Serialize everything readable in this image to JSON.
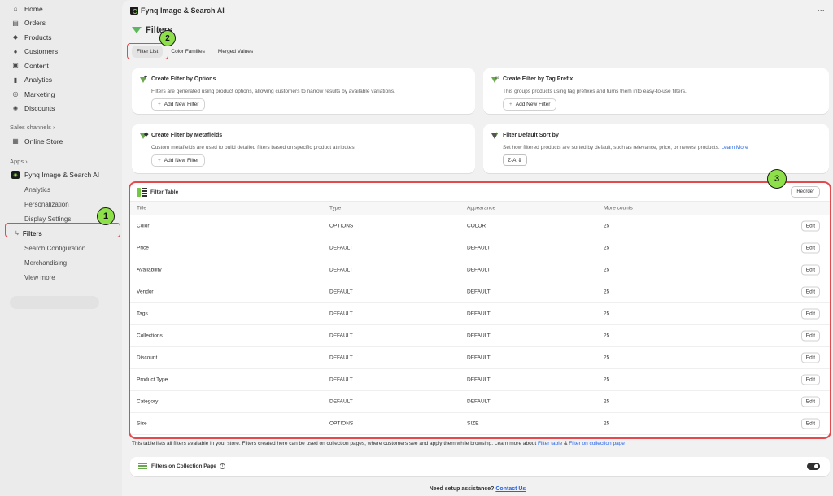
{
  "sidebar": {
    "nav": [
      {
        "label": "Home",
        "icon": "home-icon"
      },
      {
        "label": "Orders",
        "icon": "orders-icon"
      },
      {
        "label": "Products",
        "icon": "tag-icon"
      },
      {
        "label": "Customers",
        "icon": "person-icon"
      },
      {
        "label": "Content",
        "icon": "content-icon"
      },
      {
        "label": "Analytics",
        "icon": "bar-chart-icon"
      },
      {
        "label": "Marketing",
        "icon": "target-icon"
      },
      {
        "label": "Discounts",
        "icon": "discount-icon"
      }
    ],
    "sales_channels_label": "Sales channels",
    "online_store": "Online Store",
    "apps_label": "Apps",
    "app_name": "Fynq Image & Search AI",
    "app_sub": [
      "Analytics",
      "Personalization",
      "Display Settings",
      "Filters",
      "Search Configuration",
      "Merchandising",
      "View more"
    ]
  },
  "header": {
    "app_title": "Fynq Image & Search AI",
    "more": "···"
  },
  "page": {
    "title": "Filters",
    "tabs": [
      "Filter List",
      "Color Families",
      "Merged Values"
    ]
  },
  "cards": {
    "options": {
      "title": "Create Filter by Options",
      "desc": "Filters are generated using product options, allowing customers to narrow results by available variations.",
      "button": "Add New Filter"
    },
    "tag": {
      "title": "Create Filter by Tag Prefix",
      "desc": "This groups products using tag prefixes and turns them into easy-to-use filters.",
      "button": "Add New Filter"
    },
    "metafields": {
      "title": "Create Filter by Metafields",
      "desc": "Custom metafields are used to build detailed filters based on specific product attributes.",
      "button": "Add New Filter"
    },
    "sort": {
      "title": "Filter Default Sort by",
      "desc": "Set how filtered products are sorted by default, such as relevance, price, or newest products.",
      "link": "Learn More",
      "select": "Z-A"
    }
  },
  "table": {
    "title": "Filter Table",
    "reorder": "Reorder",
    "columns": [
      "Title",
      "Type",
      "Appearance",
      "More counts"
    ],
    "edit_label": "Edit",
    "rows": [
      {
        "title": "Color",
        "type": "OPTIONS",
        "appearance": "COLOR",
        "more": "25"
      },
      {
        "title": "Price",
        "type": "DEFAULT",
        "appearance": "DEFAULT",
        "more": "25"
      },
      {
        "title": "Availability",
        "type": "DEFAULT",
        "appearance": "DEFAULT",
        "more": "25"
      },
      {
        "title": "Vendor",
        "type": "DEFAULT",
        "appearance": "DEFAULT",
        "more": "25"
      },
      {
        "title": "Tags",
        "type": "DEFAULT",
        "appearance": "DEFAULT",
        "more": "25"
      },
      {
        "title": "Collections",
        "type": "DEFAULT",
        "appearance": "DEFAULT",
        "more": "25"
      },
      {
        "title": "Discount",
        "type": "DEFAULT",
        "appearance": "DEFAULT",
        "more": "25"
      },
      {
        "title": "Product Type",
        "type": "DEFAULT",
        "appearance": "DEFAULT",
        "more": "25"
      },
      {
        "title": "Category",
        "type": "DEFAULT",
        "appearance": "DEFAULT",
        "more": "25"
      },
      {
        "title": "Size",
        "type": "OPTIONS",
        "appearance": "SIZE",
        "more": "25"
      }
    ]
  },
  "footnote": {
    "text": "This table lists all filters available in your store. Filters created here can be used on collection pages, where customers see and apply them while browsing. Learn more about ",
    "link1": "Filter table",
    "amp": " & ",
    "link2": "Filter on collection page"
  },
  "collection": {
    "label": "Filters on Collection Page",
    "info": "i"
  },
  "assist": {
    "text": "Need setup assistance? ",
    "link": "Contact Us"
  },
  "badges": [
    "1",
    "2",
    "3"
  ],
  "colors": {
    "accent_green": "#8ee04a",
    "highlight_red": "#e5484d",
    "link_blue": "#2463eb"
  }
}
